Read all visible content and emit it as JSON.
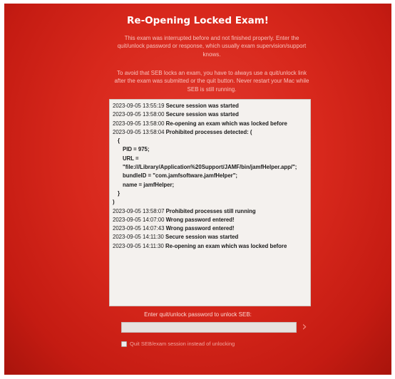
{
  "window": {
    "title": "Re-Opening Locked Exam!"
  },
  "info": {
    "paragraph1": "This exam was interrupted before and not finished properly. Enter the quit/unlock password or response, which usually exam supervision/support knows.",
    "paragraph2": "To avoid that SEB locks an exam, you have to always use a quit/unlock link after the exam was submitted or the quit button. Never restart your Mac while SEB is still running."
  },
  "log": {
    "entries": [
      {
        "ts": "2023-09-05 13:55:19",
        "msg": "Secure session was started"
      },
      {
        "ts": "2023-09-05 13:58:00",
        "msg": "Secure session was started"
      },
      {
        "ts": "2023-09-05 13:58:00",
        "msg": "Re-opening an exam which was locked before"
      },
      {
        "ts": "2023-09-05 13:58:04",
        "msg": "Prohibited processes detected: ("
      }
    ],
    "detail": {
      "open_brace": "{",
      "pid": "PID = 975;",
      "url": "URL = \"file:///Library/Application%20Support/JAMF/bin/jamfHelper.app/\";",
      "bundle": "bundleID = \"com.jamfsoftware.jamfHelper\";",
      "name": "name = jamfHelper;",
      "close_brace": "}",
      "close_paren": ")"
    },
    "entries2": [
      {
        "ts": "2023-09-05 13:58:07",
        "msg": "Prohibited processes still running"
      },
      {
        "ts": "2023-09-05 14:07:00",
        "msg": "Wrong password entered!"
      },
      {
        "ts": "2023-09-05 14:07:43",
        "msg": "Wrong password entered!"
      },
      {
        "ts": "2023-09-05 14:11:30",
        "msg": "Secure session was started"
      },
      {
        "ts": "2023-09-05 14:11:30",
        "msg": "Re-opening an exam which was locked before"
      }
    ]
  },
  "unlock": {
    "prompt": "Enter quit/unlock password to unlock SEB:",
    "password_value": "",
    "submit_icon": "chevron-right-icon",
    "quit_checkbox_label": "Quit SEB/exam session instead of unlocking",
    "quit_checked": false
  },
  "colors": {
    "background": "#d8281c",
    "log_background": "#f4f1ee"
  }
}
